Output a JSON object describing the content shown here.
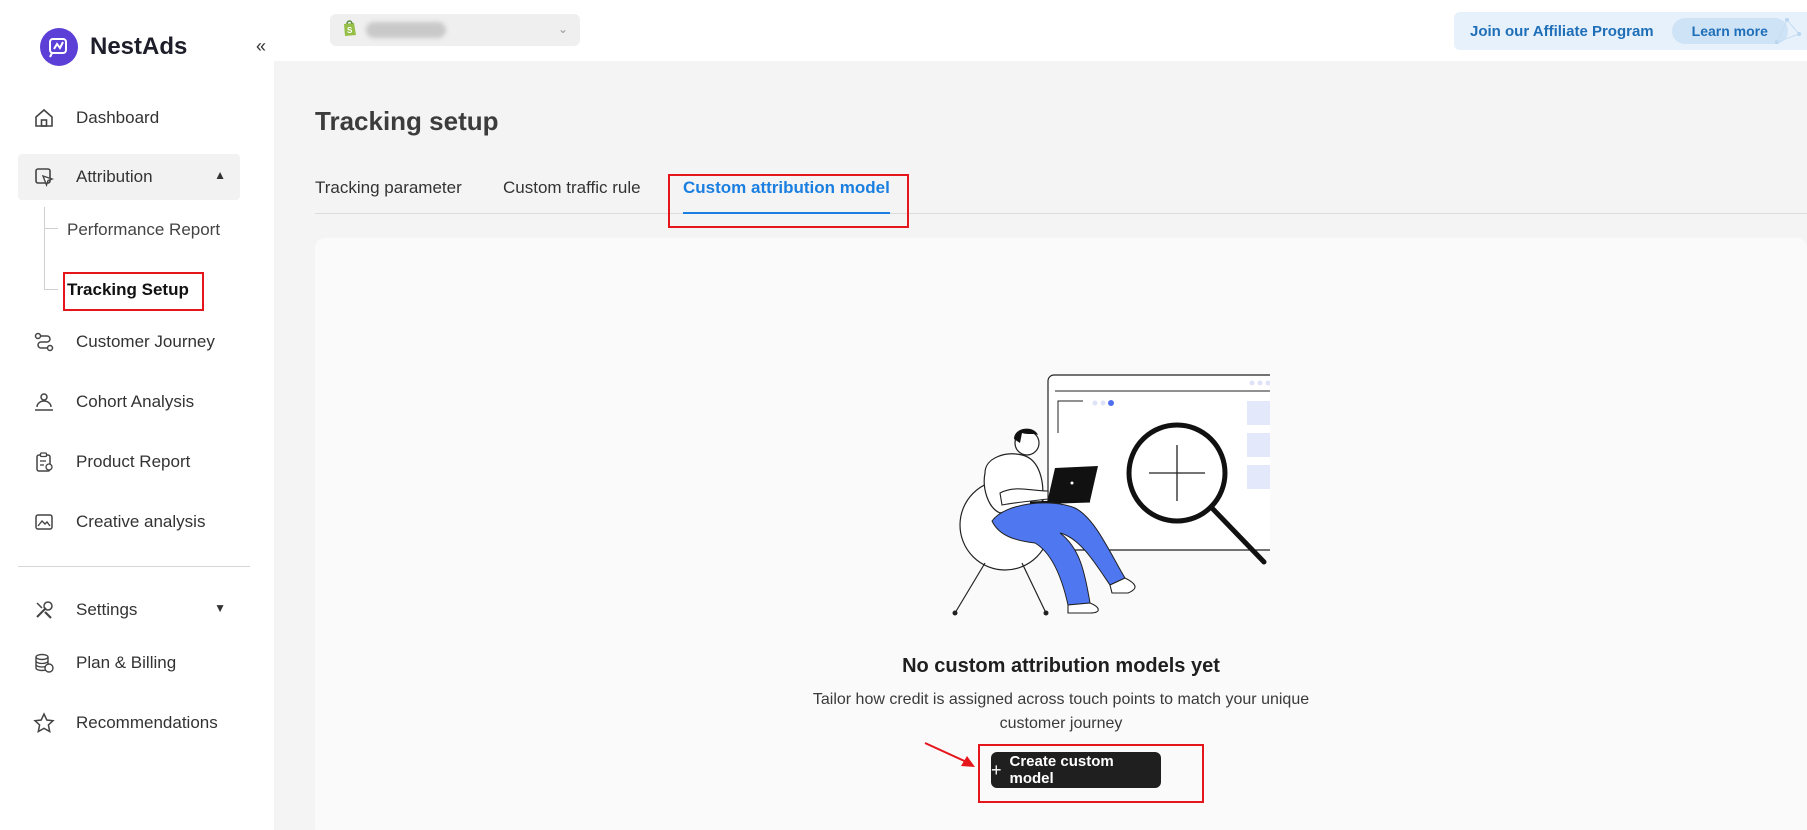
{
  "brand": {
    "name": "NestAds",
    "accent": "#5b3fd6"
  },
  "sidebar": {
    "collapse_icon": "«",
    "items": [
      {
        "label": "Dashboard",
        "icon": "home-icon"
      },
      {
        "label": "Attribution",
        "icon": "cursor-icon",
        "expanded": true
      },
      {
        "label": "Customer Journey",
        "icon": "route-icon"
      },
      {
        "label": "Cohort Analysis",
        "icon": "users-icon"
      },
      {
        "label": "Product Report",
        "icon": "clipboard-icon"
      },
      {
        "label": "Creative analysis",
        "icon": "image-icon"
      },
      {
        "label": "Settings",
        "icon": "tools-icon"
      },
      {
        "label": "Plan & Billing",
        "icon": "coins-icon"
      },
      {
        "label": "Recommendations",
        "icon": "star-icon"
      }
    ],
    "attribution_sub": [
      {
        "label": "Performance Report"
      },
      {
        "label": "Tracking Setup",
        "current": true
      }
    ]
  },
  "topbar": {
    "affiliate_text": "Join our Affiliate Program",
    "learn_more": "Learn more"
  },
  "page": {
    "title": "Tracking setup",
    "tabs": [
      {
        "label": "Tracking parameter"
      },
      {
        "label": "Custom traffic rule"
      },
      {
        "label": "Custom attribution model",
        "active": true
      }
    ],
    "empty_state": {
      "title": "No custom attribution models yet",
      "description": "Tailor how credit is assigned across touch points to match your unique customer journey",
      "button_label": "Create custom model",
      "button_icon": "+"
    }
  },
  "colors": {
    "tab_active": "#1a7fe0",
    "highlight": "#e4151b",
    "button_bg": "#1f1f1f"
  }
}
